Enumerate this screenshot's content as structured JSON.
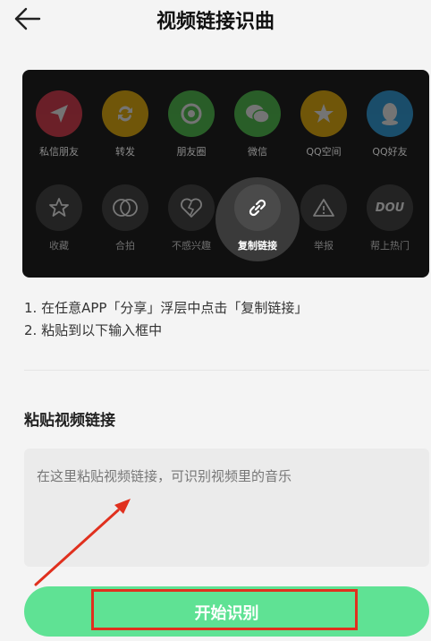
{
  "header": {
    "title": "视频链接识曲",
    "back_icon": "arrow-left-icon"
  },
  "share_panel": {
    "row1": [
      {
        "label": "私信朋友",
        "icon": "send-icon",
        "color": "#e8364a"
      },
      {
        "label": "转发",
        "icon": "repost-icon",
        "color": "#f5b800"
      },
      {
        "label": "朋友圈",
        "icon": "moments-icon",
        "color": "#4cc94a"
      },
      {
        "label": "微信",
        "icon": "wechat-icon",
        "color": "#4cc94a"
      },
      {
        "label": "QQ空间",
        "icon": "qzone-star-icon",
        "color": "#f5b800"
      },
      {
        "label": "QQ好友",
        "icon": "qq-icon",
        "color": "#2aa3e8"
      }
    ],
    "row2": [
      {
        "label": "收藏",
        "icon": "star-icon"
      },
      {
        "label": "合拍",
        "icon": "duet-icon"
      },
      {
        "label": "不感兴趣",
        "icon": "broken-heart-icon"
      },
      {
        "label": "复制链接",
        "icon": "link-icon",
        "active": true
      },
      {
        "label": "举报",
        "icon": "warning-icon"
      },
      {
        "label": "帮上热门",
        "icon": "dou-plus-icon",
        "icon_text": "DOU"
      }
    ]
  },
  "instructions": [
    "1. 在任意APP「分享」浮层中点击「复制链接」",
    "2. 粘贴到以下输入框中"
  ],
  "input_section": {
    "title": "粘贴视频链接",
    "placeholder": "在这里粘贴视频链接，可识别视频里的音乐",
    "value": ""
  },
  "start_button": {
    "label": "开始识别"
  },
  "colors": {
    "accent": "#5fe294",
    "annotation": "#e0301e"
  }
}
